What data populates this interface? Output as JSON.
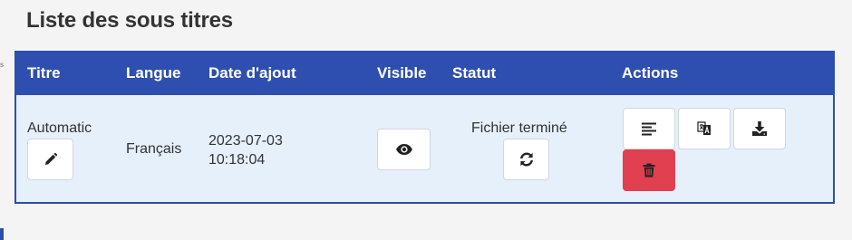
{
  "page": {
    "title": "Liste des sous titres",
    "side_mark": "s"
  },
  "table": {
    "headers": {
      "titre": "Titre",
      "langue": "Langue",
      "date": "Date d'ajout",
      "visible": "Visible",
      "statut": "Statut",
      "actions": "Actions"
    },
    "rows": [
      {
        "titre": "Automatic",
        "langue": "Français",
        "date_day": "2023-07-03",
        "date_time": "10:18:04",
        "statut": "Fichier terminé",
        "icons": {
          "edit": "pencil-icon",
          "visible": "eye-icon",
          "refresh": "refresh-icon",
          "text": "align-left-icon",
          "translate": "translate-icon",
          "download": "download-icon",
          "delete": "trash-icon"
        }
      }
    ]
  },
  "colors": {
    "header_bg": "#2f4fb0",
    "row_bg": "#e6f0fb",
    "delete_bg": "#e0404f",
    "page_bg": "#f4f4f4"
  }
}
